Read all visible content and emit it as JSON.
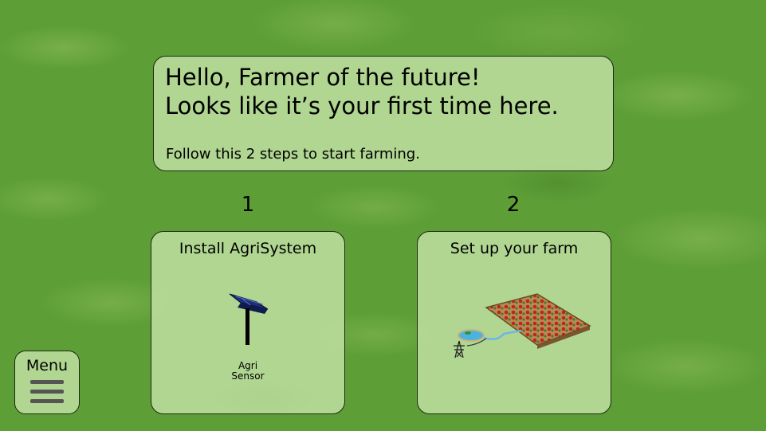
{
  "welcome": {
    "line1": "Hello, Farmer of the future!",
    "line2": "Looks like it’s your first time here.",
    "subtitle": "Follow this 2 steps to start farming."
  },
  "steps": [
    {
      "number": "1",
      "title": "Install AgriSystem",
      "caption_line1": "Agri",
      "caption_line2": "Sensor",
      "icon": "agri-sensor-icon"
    },
    {
      "number": "2",
      "title": "Set up your farm",
      "icon": "farm-field-icon"
    }
  ],
  "menu": {
    "label": "Menu",
    "icon": "hamburger-icon"
  },
  "colors": {
    "grass": "#5e9e37",
    "panel": "#c8e6aa",
    "border": "#1b2a12"
  }
}
